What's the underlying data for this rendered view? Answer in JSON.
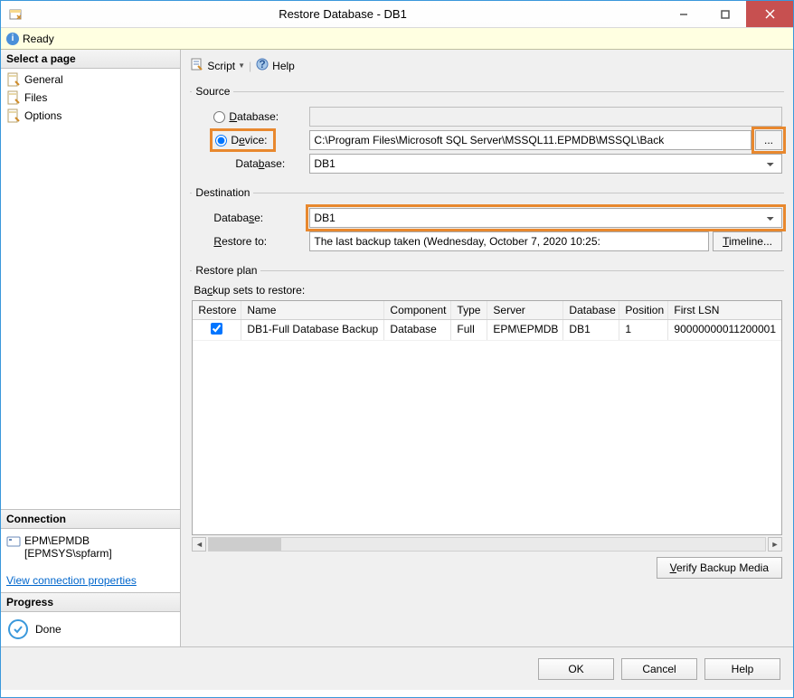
{
  "window": {
    "title": "Restore Database - DB1",
    "ready_label": "Ready"
  },
  "sidebar": {
    "select_page_label": "Select a page",
    "pages": [
      {
        "label": "General",
        "icon": "page-general"
      },
      {
        "label": "Files",
        "icon": "page-files"
      },
      {
        "label": "Options",
        "icon": "page-options"
      }
    ],
    "connection": {
      "header": "Connection",
      "server": "EPM\\EPMDB",
      "user": "[EPMSYS\\spfarm]",
      "view_link": "View connection properties"
    },
    "progress": {
      "header": "Progress",
      "status": "Done"
    }
  },
  "toolbar": {
    "script_label": "Script",
    "help_label": "Help"
  },
  "source": {
    "legend": "Source",
    "database_radio_label": "Database:",
    "device_radio_label": "Device:",
    "device_path": "C:\\Program Files\\Microsoft SQL Server\\MSSQL11.EPMDB\\MSSQL\\Back",
    "database_sub_label": "Database:",
    "database_value": "DB1",
    "browse_label": "...",
    "selected_radio": "device"
  },
  "destination": {
    "legend": "Destination",
    "database_label": "Database:",
    "database_value": "DB1",
    "restore_to_label": "Restore to:",
    "restore_to_value": "The last backup taken (Wednesday, October 7, 2020 10:25:",
    "timeline_label": "Timeline..."
  },
  "restore_plan": {
    "legend": "Restore plan",
    "sets_label": "Backup sets to restore:",
    "columns": {
      "restore": "Restore",
      "name": "Name",
      "component": "Component",
      "type": "Type",
      "server": "Server",
      "database": "Database",
      "position": "Position",
      "first_lsn": "First LSN"
    },
    "rows": [
      {
        "restore": true,
        "name": "DB1-Full Database Backup",
        "component": "Database",
        "type": "Full",
        "server": "EPM\\EPMDB",
        "database": "DB1",
        "position": "1",
        "first_lsn": "90000000011200001"
      }
    ],
    "verify_label": "Verify Backup Media"
  },
  "footer": {
    "ok": "OK",
    "cancel": "Cancel",
    "help": "Help"
  }
}
